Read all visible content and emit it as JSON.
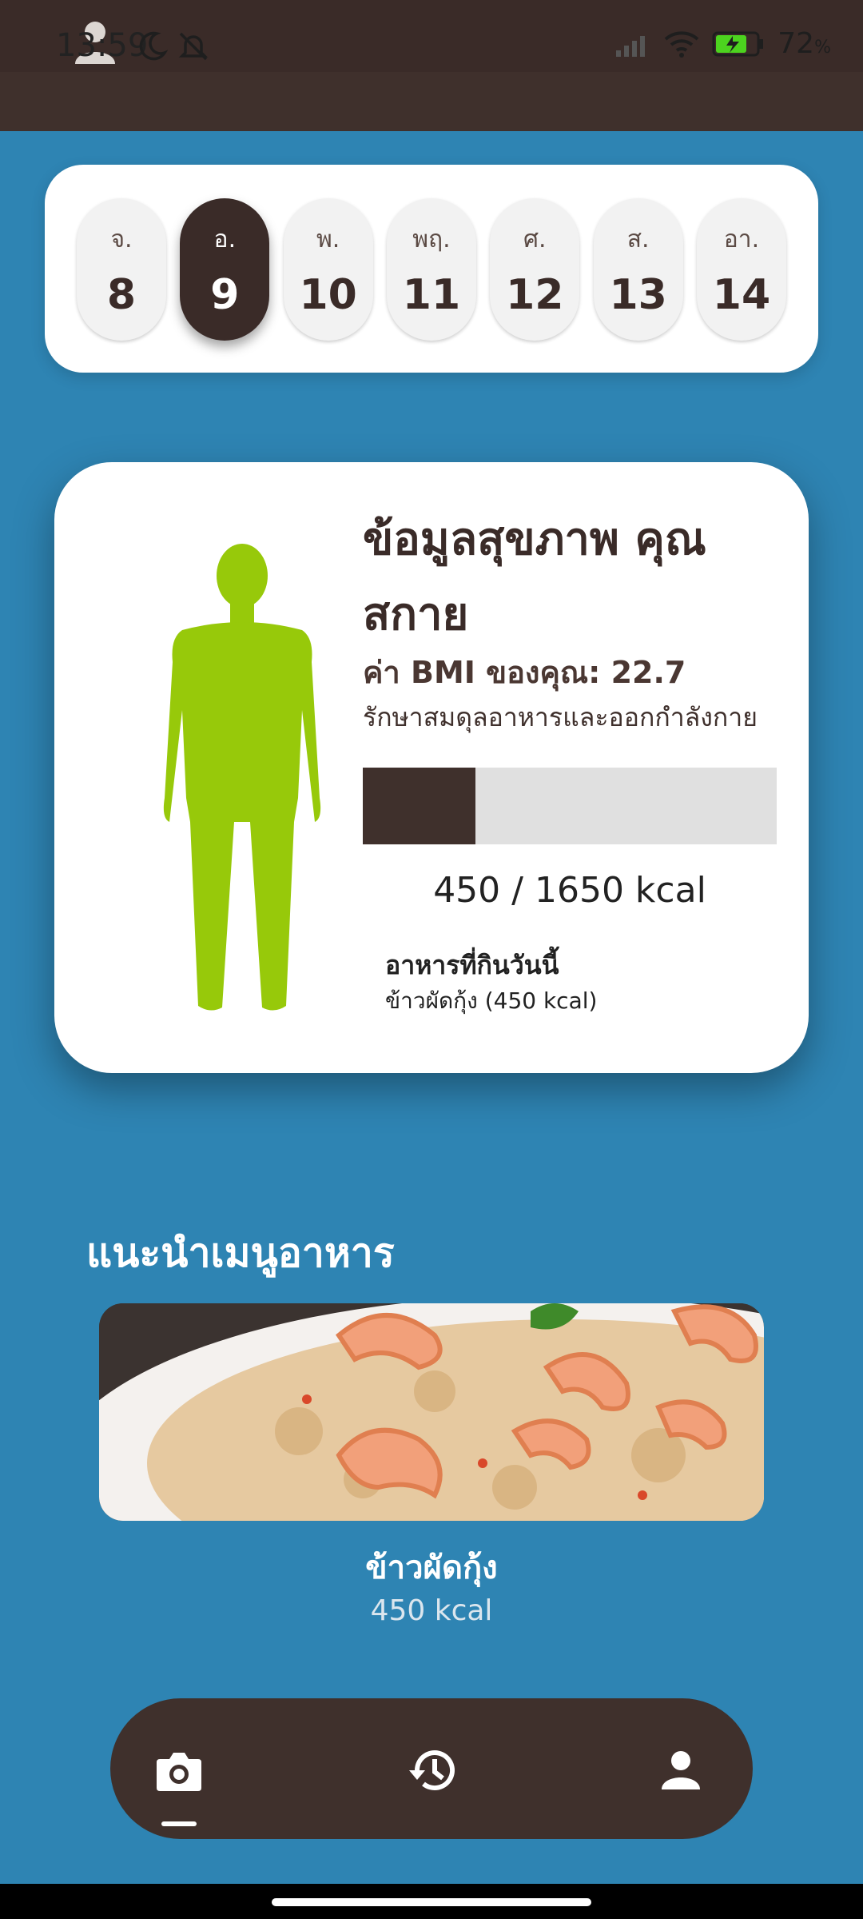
{
  "status_bar": {
    "time": "13:59",
    "battery_percent": "72"
  },
  "week": {
    "days": [
      {
        "dow": "จ.",
        "num": "8"
      },
      {
        "dow": "อ.",
        "num": "9",
        "selected": true
      },
      {
        "dow": "พ.",
        "num": "10"
      },
      {
        "dow": "พฤ.",
        "num": "11"
      },
      {
        "dow": "ศ.",
        "num": "12"
      },
      {
        "dow": "ส.",
        "num": "13"
      },
      {
        "dow": "อา.",
        "num": "14"
      }
    ]
  },
  "health": {
    "title": "ข้อมูลสุขภาพ คุณสกาย",
    "bmi_text": "ค่า BMI ของคุณ: 22.7",
    "advice": "รักษาสมดุลอาหารและออกกำลังกาย",
    "kcal_consumed": 450,
    "kcal_goal": 1650,
    "kcal_text": "450 / 1650 kcal",
    "eaten_title": "อาหารที่กินวันนี้",
    "eaten_item": "ข้าวผัดกุ้ง (450 kcal)"
  },
  "recommendation": {
    "section_title": "แนะนำเมนูอาหาร",
    "food_name": "ข้าวผัดกุ้ง",
    "food_kcal": "450 kcal"
  },
  "nav": {
    "items": [
      "camera-icon",
      "history-icon",
      "profile-icon"
    ],
    "active_index": 0
  },
  "colors": {
    "background": "#2e84b3",
    "brown": "#3f302c",
    "body_green": "#97c90a"
  }
}
